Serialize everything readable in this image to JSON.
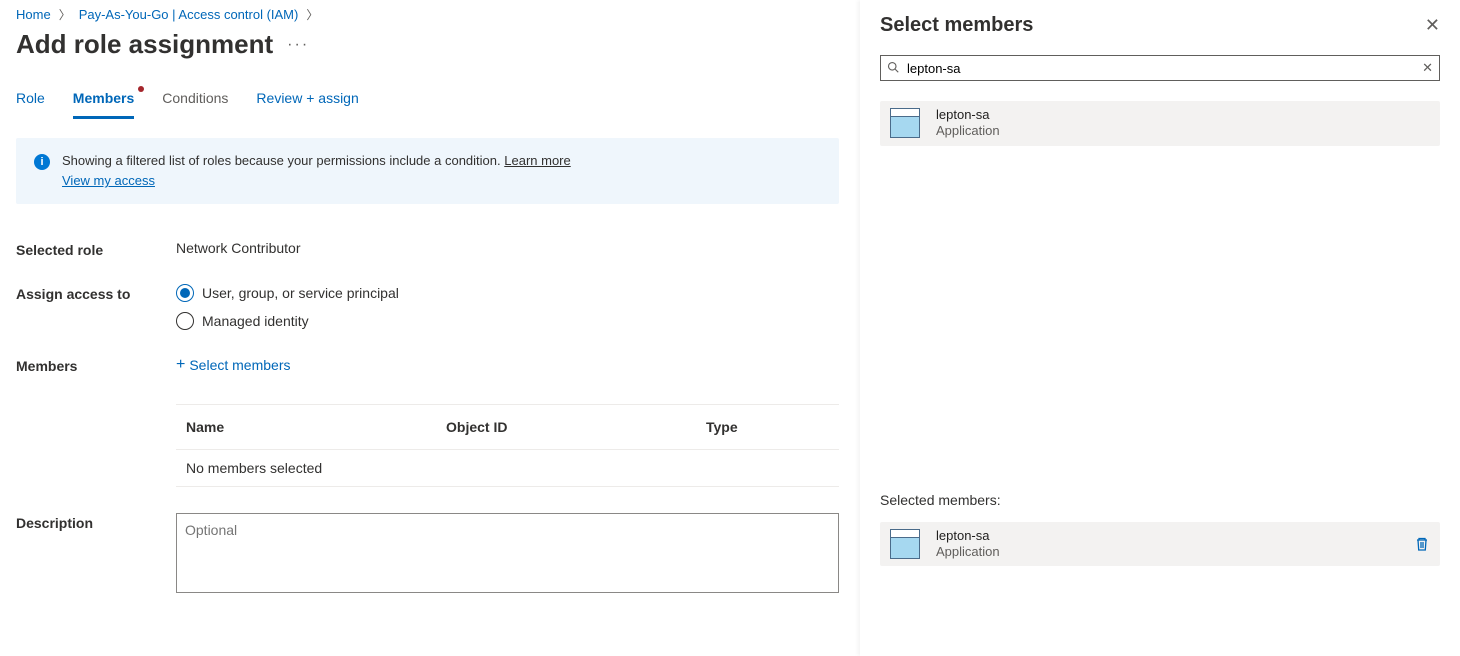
{
  "breadcrumb": {
    "home": "Home",
    "scope": "Pay-As-You-Go | Access control (IAM)"
  },
  "page_title": "Add role assignment",
  "tabs": {
    "role": "Role",
    "members": "Members",
    "conditions": "Conditions",
    "review": "Review + assign"
  },
  "banner": {
    "message": "Showing a filtered list of roles because your permissions include a condition.",
    "learn": "Learn more",
    "view": "View my access"
  },
  "form": {
    "selected_role_label": "Selected role",
    "selected_role_value": "Network Contributor",
    "assign_label": "Assign access to",
    "assign_opt_user": "User, group, or service principal",
    "assign_opt_mi": "Managed identity",
    "members_label": "Members",
    "select_members": "Select members",
    "table": {
      "col_name": "Name",
      "col_obj": "Object ID",
      "col_type": "Type",
      "empty": "No members selected"
    },
    "description_label": "Description",
    "description_placeholder": "Optional"
  },
  "panel": {
    "title": "Select members",
    "search_value": "lepton-sa",
    "results": [
      {
        "name": "lepton-sa",
        "type": "Application"
      }
    ],
    "selected_header": "Selected members:",
    "selected": [
      {
        "name": "lepton-sa",
        "type": "Application"
      }
    ]
  }
}
